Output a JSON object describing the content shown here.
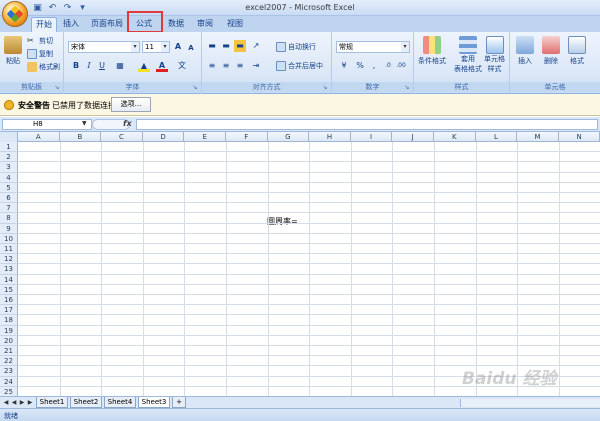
{
  "window": {
    "title": "excel2007 - Microsoft Excel"
  },
  "quick_access": {
    "icons": [
      "save-icon",
      "undo-icon",
      "redo-icon",
      "customize-icon"
    ]
  },
  "tabs": [
    "开始",
    "插入",
    "页面布局",
    "公式",
    "数据",
    "审阅",
    "视图"
  ],
  "ribbon": {
    "clipboard": {
      "paste": "粘贴",
      "cut": "剪切",
      "copy": "复制",
      "format_painter": "格式刷",
      "label": "剪贴板"
    },
    "font": {
      "name": "宋体",
      "size": "11",
      "label": "字体",
      "bold": "B",
      "italic": "I",
      "underline": "U"
    },
    "alignment": {
      "wrap": "自动换行",
      "merge": "合并后居中",
      "label": "对齐方式"
    },
    "number": {
      "format": "常规",
      "label": "数字"
    },
    "styles": {
      "conditional": "条件格式",
      "table": "套用",
      "table2": "表格格式",
      "cell": "单元格",
      "cell2": "样式",
      "label": "样式"
    },
    "cells": {
      "insert": "插入",
      "delete": "删除",
      "format": "格式",
      "label": "单元格"
    }
  },
  "security": {
    "title": "安全警告",
    "message": "已禁用了数据连接",
    "options_button": "选项..."
  },
  "formula_bar": {
    "name_box": "H8",
    "fx": "fx",
    "value": ""
  },
  "grid": {
    "columns": [
      "A",
      "B",
      "C",
      "D",
      "E",
      "F",
      "G",
      "H",
      "I",
      "J",
      "K",
      "L",
      "M",
      "N"
    ],
    "rows": [
      "1",
      "2",
      "3",
      "4",
      "5",
      "6",
      "7",
      "8",
      "9",
      "10",
      "11",
      "12",
      "13",
      "14",
      "15",
      "16",
      "17",
      "18",
      "19",
      "20",
      "21",
      "22",
      "23",
      "24",
      "25"
    ],
    "cell_g8": "圆周率="
  },
  "sheets": [
    "Sheet1",
    "Sheet2",
    "Sheet4",
    "Sheet3"
  ],
  "active_sheet": "Sheet3",
  "status": {
    "text": "就绪"
  },
  "watermark": "Baidu 经验"
}
